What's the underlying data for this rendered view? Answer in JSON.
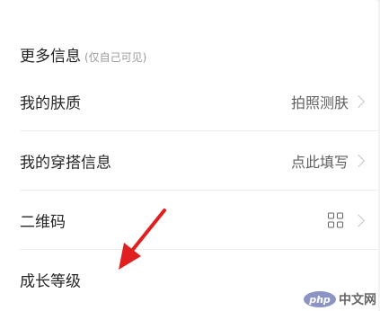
{
  "section": {
    "title": "更多信息",
    "note": "(仅自己可见)"
  },
  "rows": [
    {
      "label": "我的肤质",
      "value": "拍照测肤"
    },
    {
      "label": "我的穿搭信息",
      "value": "点此填写"
    },
    {
      "label": "二维码",
      "icon": "qr-code-icon"
    },
    {
      "label": "成长等级"
    }
  ],
  "annotation": {
    "arrow_color": "#e02020"
  },
  "watermark": {
    "badge": "php",
    "text": "中文网"
  },
  "colors": {
    "background": "#ffffff",
    "divider": "#ececec",
    "text_primary": "#262626",
    "text_secondary": "#5f5f5f",
    "text_note": "#9a9a9a"
  }
}
